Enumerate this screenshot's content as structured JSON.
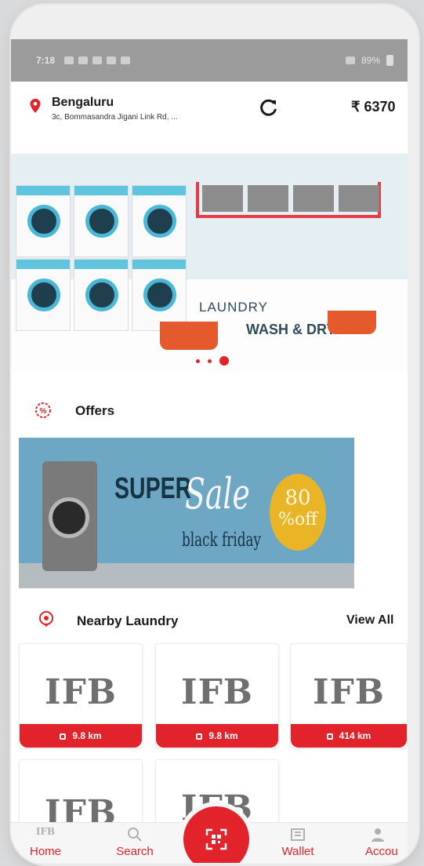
{
  "statusbar": {
    "time": "7:18",
    "battery": "89%"
  },
  "location": {
    "city": "Bengaluru",
    "address": "3c, Bommasandra Jigani Link Rd, ..."
  },
  "wallet_balance": "₹ 6370",
  "banner": {
    "line1": "LAUNDRY",
    "line2": "WASH & DRY"
  },
  "offers": {
    "title": "Offers"
  },
  "offer_banner": {
    "super": "SUPER",
    "sale": "Sale",
    "black_friday": "black friday",
    "pct": "80",
    "off": "%off"
  },
  "nearby": {
    "title": "Nearby Laundry",
    "view_all": "View All",
    "cards": [
      {
        "logo": "IFB",
        "distance": "9.8 km"
      },
      {
        "logo": "IFB",
        "distance": "9.8 km"
      },
      {
        "logo": "IFB",
        "distance": "414 km"
      },
      {
        "logo": "IFB"
      },
      {
        "logo": "IFB"
      }
    ]
  },
  "nav": {
    "home": "Home",
    "home_logo": "IFB",
    "search": "Search",
    "wallet": "Wallet",
    "account": "Accou"
  },
  "colors": {
    "accent": "#e2232b",
    "text": "#1a1a1a",
    "card_logo": "#6f6f6f"
  }
}
